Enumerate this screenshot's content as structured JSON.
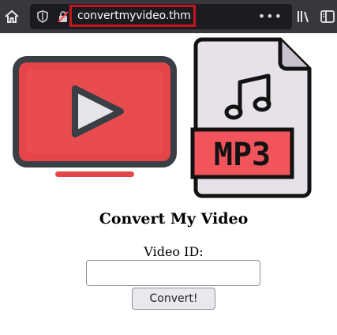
{
  "browser": {
    "url": "convertmyvideo.thm",
    "page_actions_label": "•••",
    "icons": [
      "home-icon",
      "shield-icon",
      "lock-icon",
      "library-icon",
      "sidebar-icon"
    ]
  },
  "page": {
    "heading": "Convert My Video",
    "video_id_label": "Video ID:",
    "video_id_value": "",
    "convert_button_label": "Convert!",
    "mp3_label": "MP3"
  },
  "colors": {
    "toolbar": "#38373d",
    "urlbar": "#1c1b22",
    "url_highlight": "#c4151c",
    "tv_red": "#e54448",
    "mp3_red": "#f2545b"
  }
}
